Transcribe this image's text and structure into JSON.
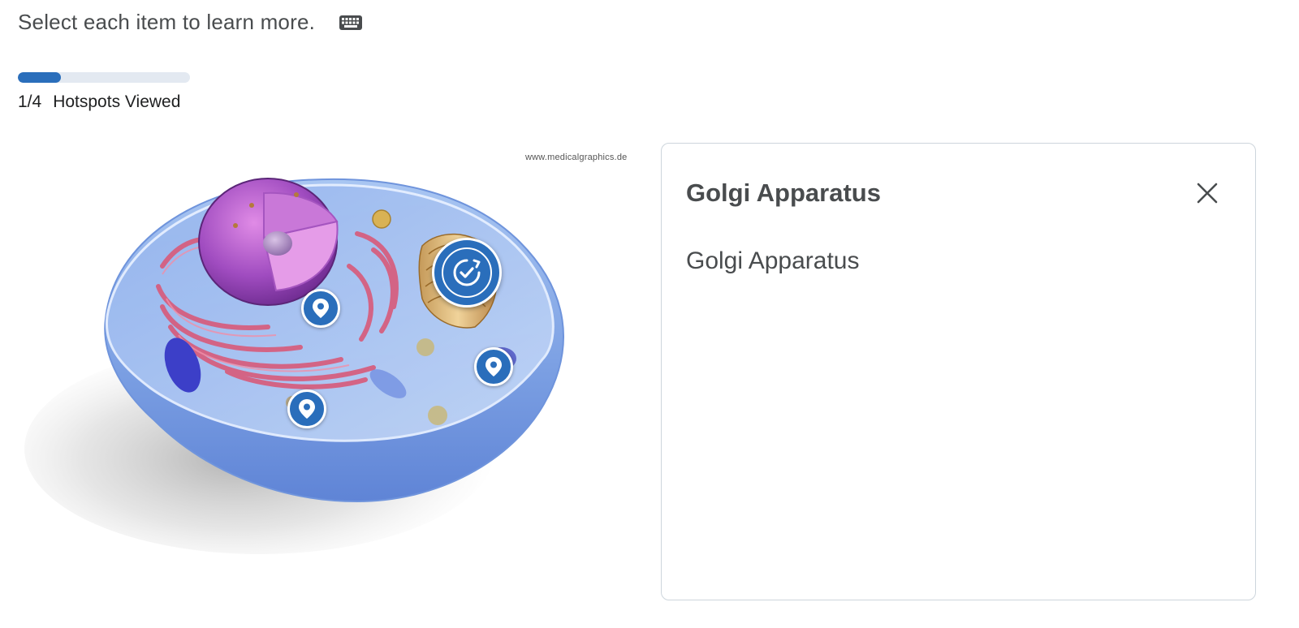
{
  "instructions": {
    "text": "Select each item to learn more.",
    "keyboard_icon": "keyboard-icon"
  },
  "progress": {
    "viewed": 1,
    "total": 4,
    "fraction": 0.25,
    "count_label": "1/4",
    "label": "Hotspots Viewed",
    "fill_color": "#2a6ebb",
    "track_color": "#e3e9f1"
  },
  "image": {
    "credit": "www.medicalgraphics.de"
  },
  "hotspots": [
    {
      "name": "hotspot-endoplasmic-reticulum",
      "icon": "map-pin-icon",
      "state": "unviewed"
    },
    {
      "name": "hotspot-golgi-apparatus",
      "icon": "check-circle-icon",
      "state": "viewed-active"
    },
    {
      "name": "hotspot-lower-left",
      "icon": "map-pin-icon",
      "state": "unviewed"
    },
    {
      "name": "hotspot-right",
      "icon": "map-pin-icon",
      "state": "unviewed"
    }
  ],
  "panel": {
    "title": "Golgi Apparatus",
    "body": "Golgi Apparatus",
    "close_icon": "close-icon"
  },
  "colors": {
    "accent": "#2a6ebb",
    "text": "#494c4e",
    "panel_border": "#cdd5dc"
  }
}
